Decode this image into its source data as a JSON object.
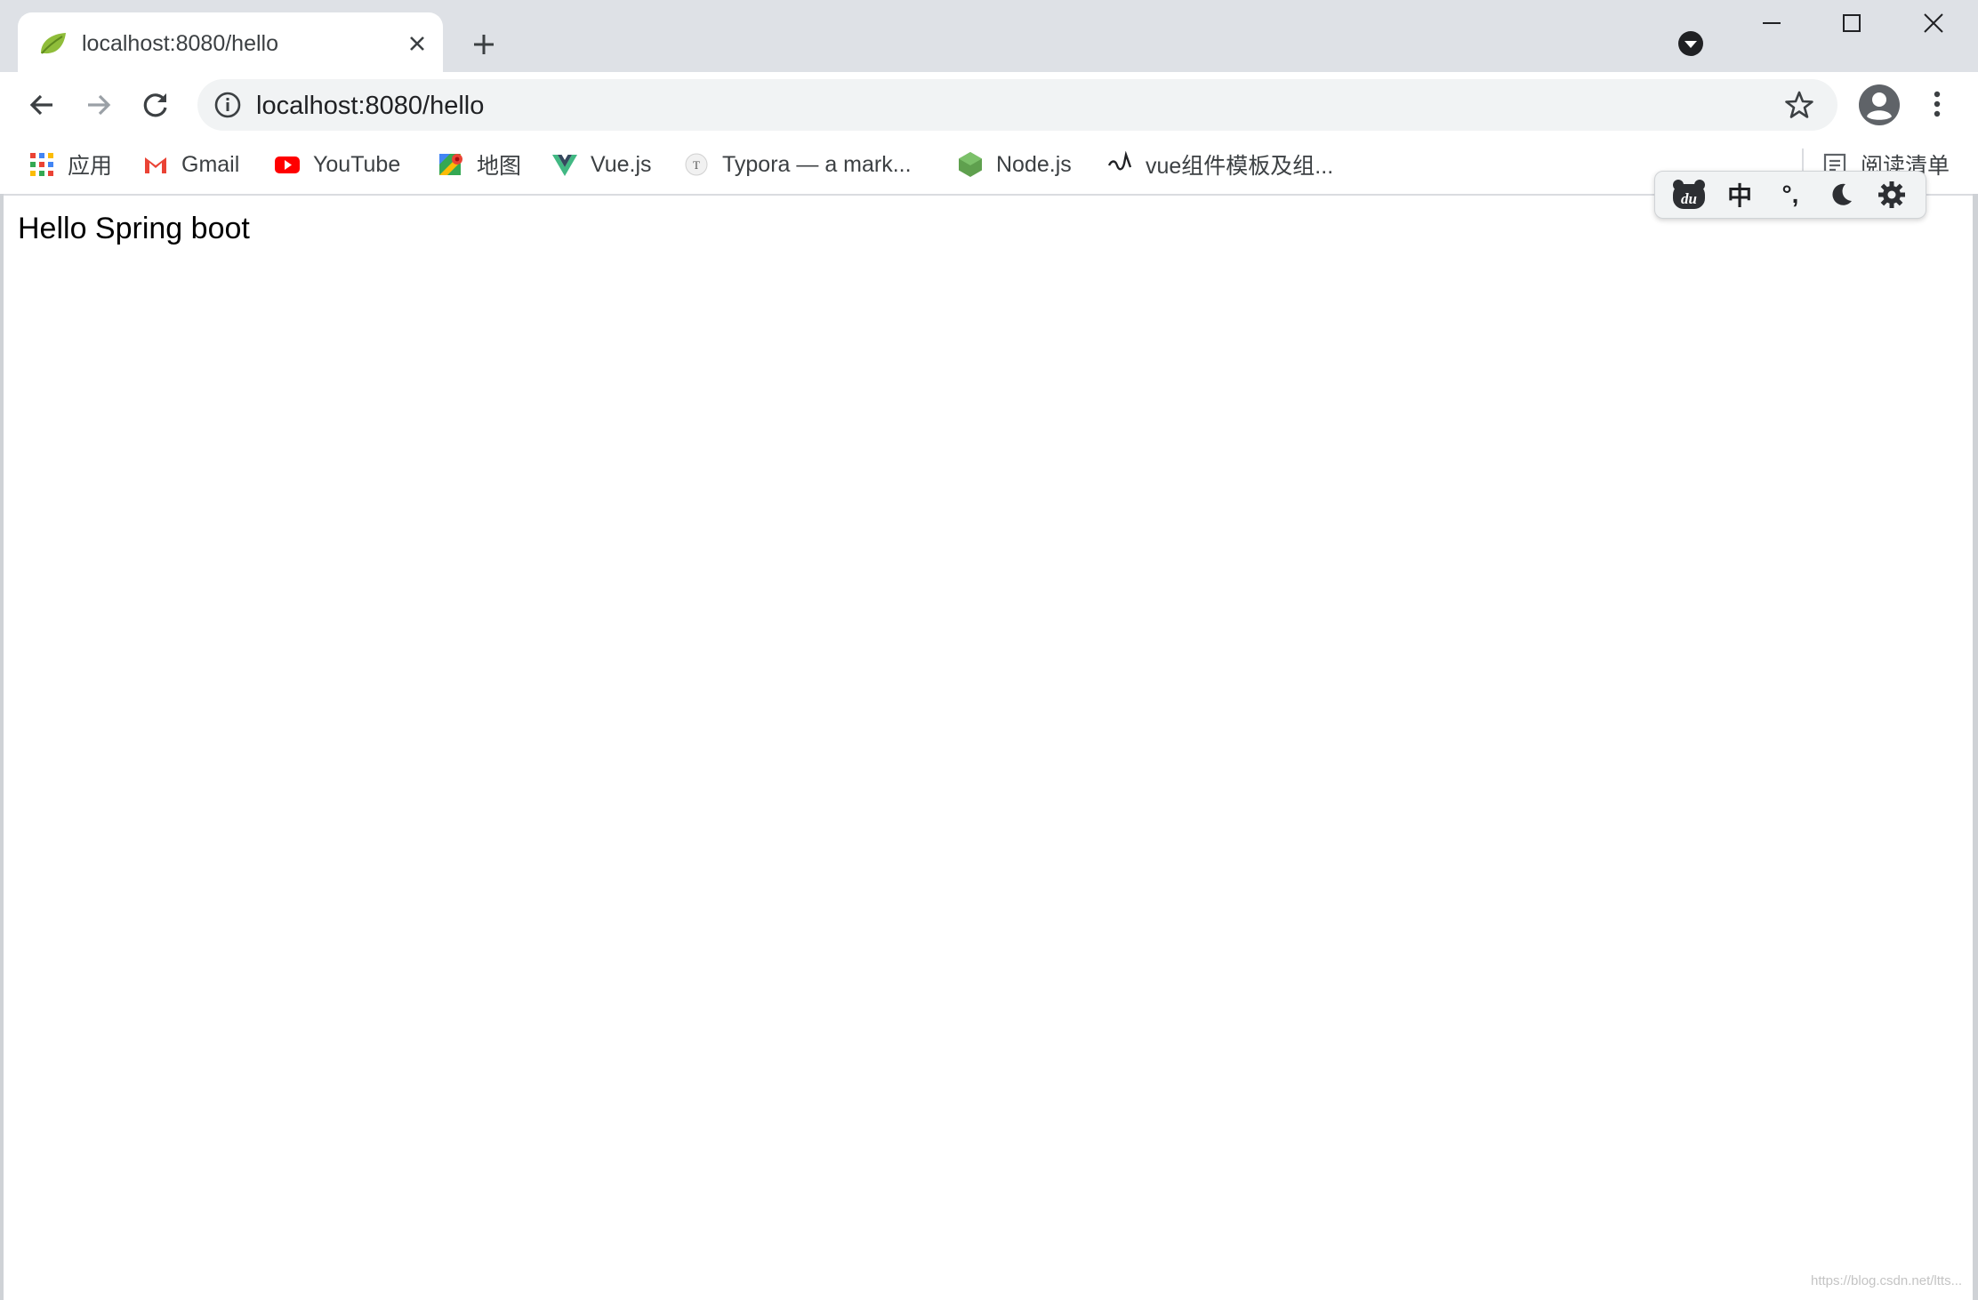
{
  "tab": {
    "title": "localhost:8080/hello",
    "favicon": "spring-leaf-icon"
  },
  "omnibox": {
    "url": "localhost:8080/hello"
  },
  "bookmarks": {
    "items": [
      {
        "label": "应用",
        "icon": "apps-grid-icon"
      },
      {
        "label": "Gmail",
        "icon": "gmail-icon"
      },
      {
        "label": "YouTube",
        "icon": "youtube-icon"
      },
      {
        "label": "地图",
        "icon": "maps-icon"
      },
      {
        "label": "Vue.js",
        "icon": "vue-icon"
      },
      {
        "label": "Typora — a mark...",
        "icon": "typora-icon"
      },
      {
        "label": "Node.js",
        "icon": "nodejs-icon"
      },
      {
        "label": "vue组件模板及组...",
        "icon": "link-icon"
      }
    ],
    "reading_list": "阅读清单"
  },
  "page": {
    "text": "Hello Spring boot"
  },
  "widget": {
    "lang": "中",
    "punct": "°,"
  },
  "watermark": "https://blog.csdn.net/ltts..."
}
